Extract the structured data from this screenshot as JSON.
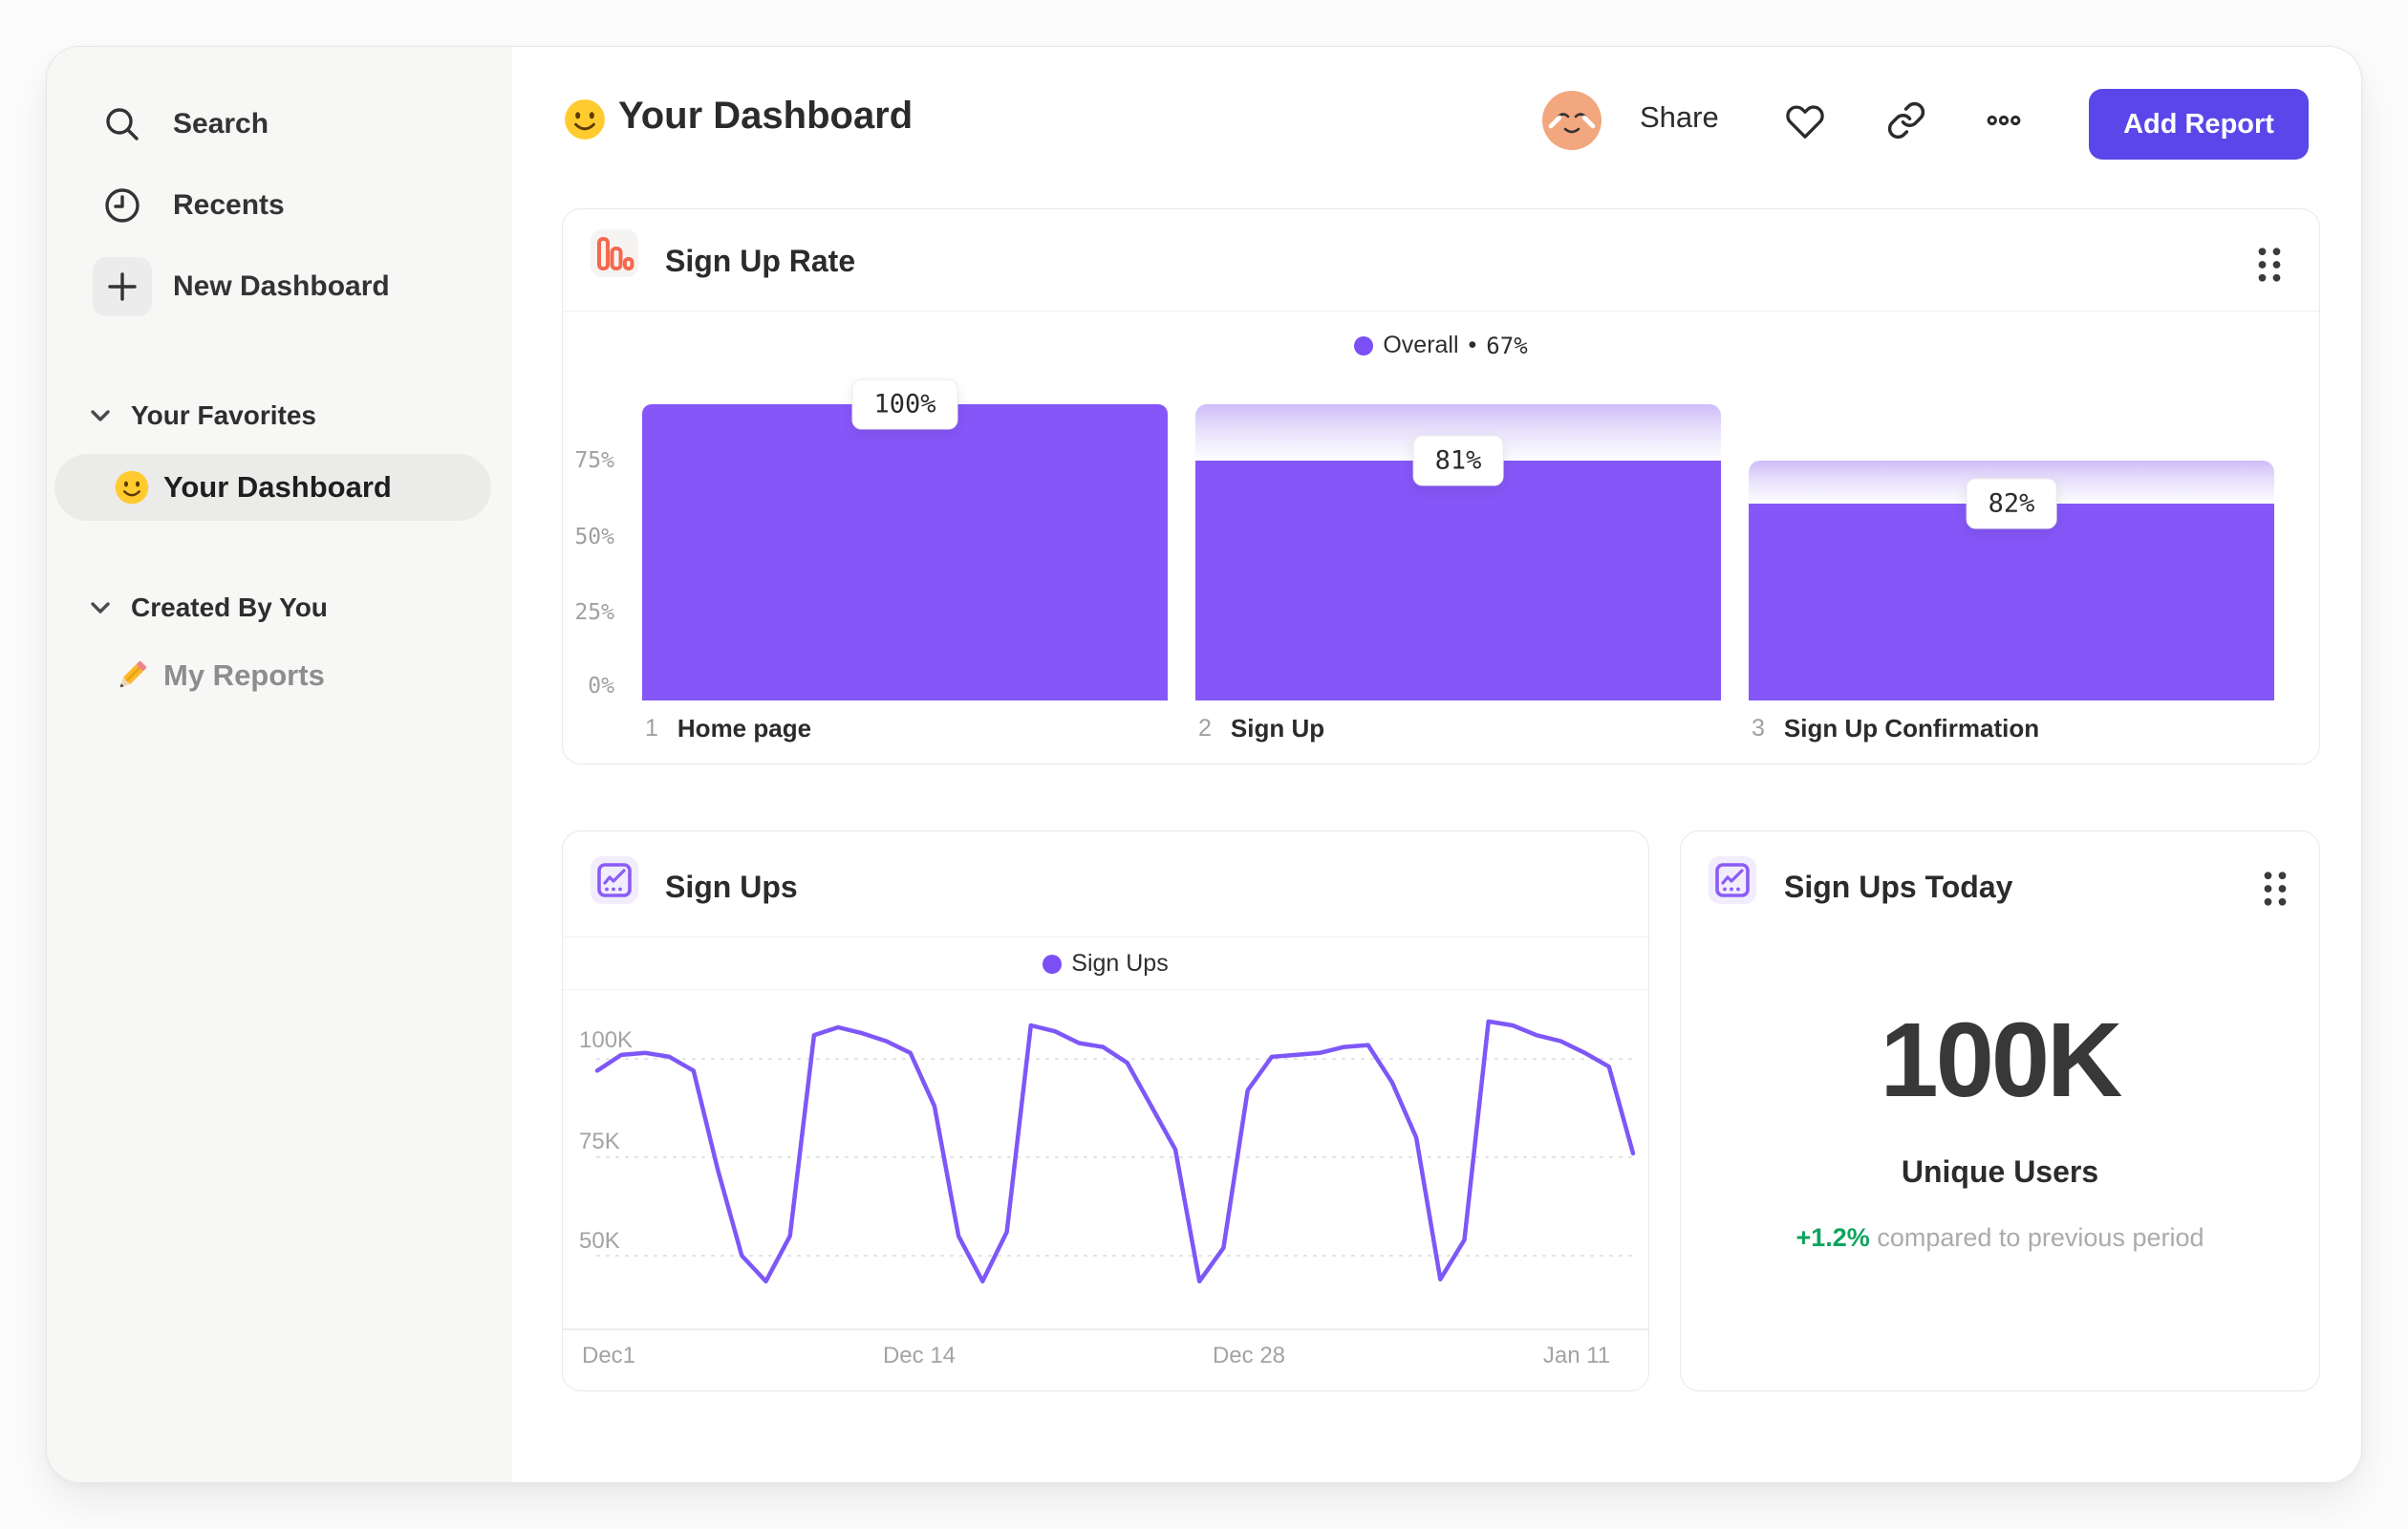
{
  "header": {
    "title": "Your Dashboard",
    "share_label": "Share",
    "add_report_label": "Add Report"
  },
  "sidebar": {
    "nav": [
      {
        "label": "Search"
      },
      {
        "label": "Recents"
      },
      {
        "label": "New Dashboard"
      }
    ],
    "sections": [
      {
        "header": "Your Favorites"
      },
      {
        "header": "Created By You"
      }
    ],
    "favorite_item": {
      "label": "Your Dashboard",
      "selected": true
    },
    "created_item": {
      "label": "My Reports",
      "selected": false
    }
  },
  "cards": {
    "signup_rate": {
      "title": "Sign Up Rate",
      "legend": {
        "label": "Overall",
        "bullet": "•",
        "value": "67%"
      },
      "y_ticks": [
        "75%",
        "50%",
        "25%",
        "0%"
      ],
      "steps": [
        {
          "index": "1",
          "label": "Home page",
          "value": "100%"
        },
        {
          "index": "2",
          "label": "Sign Up",
          "value": "81%"
        },
        {
          "index": "3",
          "label": "Sign Up Confirmation",
          "value": "82%"
        }
      ]
    },
    "sign_ups": {
      "title": "Sign Ups",
      "legend": {
        "label": "Sign Ups"
      },
      "y_ticks": [
        "100K",
        "75K",
        "50K"
      ],
      "x_ticks": [
        "Dec1",
        "Dec 14",
        "Dec 28",
        "Jan 11"
      ]
    },
    "sign_ups_today": {
      "title": "Sign Ups Today",
      "value": "100K",
      "subtitle": "Unique Users",
      "delta": "+1.2%",
      "delta_note": "compared to previous period"
    }
  },
  "chart_data": [
    {
      "type": "bar",
      "title": "Sign Up Rate",
      "categories": [
        "Home page",
        "Sign Up",
        "Sign Up Confirmation"
      ],
      "values": [
        100,
        81,
        82
      ],
      "value_format": "percent of previous step",
      "overall_conversion_pct": 67,
      "legend": [
        "Overall"
      ],
      "ylim": [
        0,
        100
      ],
      "yticks": [
        0,
        25,
        50,
        75
      ],
      "grid": false
    },
    {
      "type": "line",
      "title": "Sign Ups",
      "series": [
        {
          "name": "Sign Ups",
          "unit": "thousands of users",
          "values": [
            97,
            101,
            101.5,
            100.5,
            97,
            72,
            50,
            43.5,
            55,
            106,
            108,
            106.5,
            104.5,
            101.5,
            88,
            55,
            43.5,
            56,
            108.5,
            107,
            104,
            103,
            99,
            88,
            77,
            43.5,
            52,
            92,
            100.5,
            101,
            101.5,
            103,
            103.5,
            94,
            80,
            44,
            54,
            109.5,
            108.5,
            106,
            104.5,
            101.5,
            98,
            76
          ]
        }
      ],
      "x_tick_labels": [
        "Dec1",
        "Dec 14",
        "Dec 28",
        "Jan 11"
      ],
      "x_tick_indices": [
        0,
        13,
        27,
        41
      ],
      "ytick_labels": [
        "50K",
        "75K",
        "100K"
      ],
      "yticks": [
        50,
        75,
        100
      ],
      "ylim": [
        40,
        112
      ],
      "grid": "dashed-horizontal",
      "legend_position": "top-center"
    }
  ],
  "colors": {
    "accent_purple": "#8657F8",
    "line_purple": "#7E57F7",
    "button_purple": "#5B46E9",
    "legend_dot_purple": "#7B4FF6",
    "funnel_icon_orange": "#F4694C",
    "positive_green": "#0CA45E",
    "sidebar_bg": "#f7f7f6"
  }
}
